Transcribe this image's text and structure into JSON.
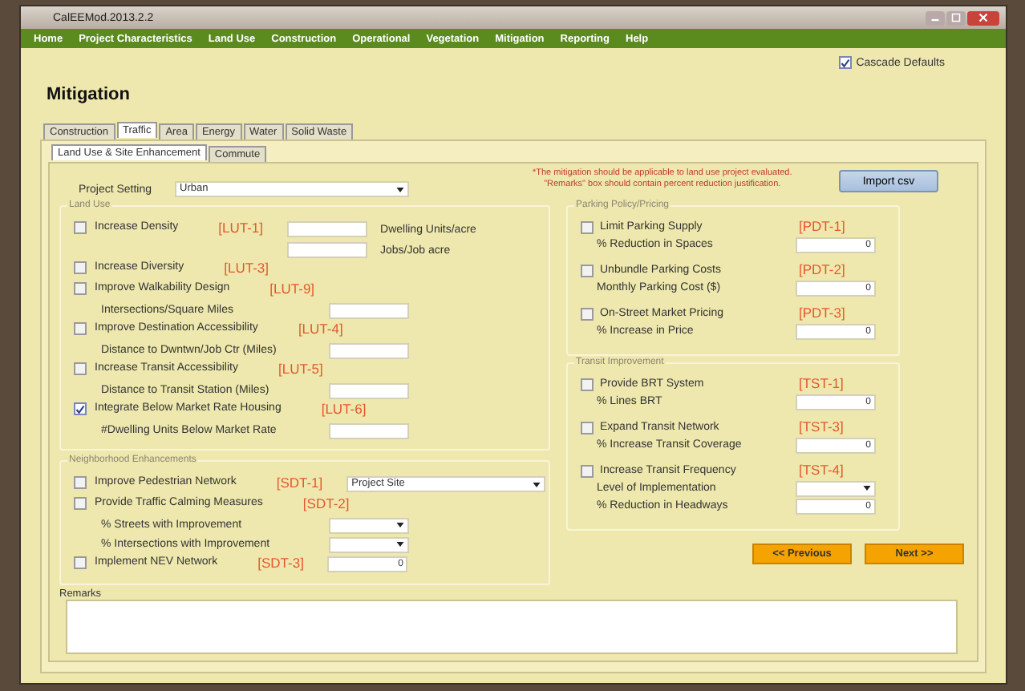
{
  "window": {
    "title": "CalEEMod.2013.2.2"
  },
  "menu": [
    "Home",
    "Project Characteristics",
    "Land Use",
    "Construction",
    "Operational",
    "Vegetation",
    "Mitigation",
    "Reporting",
    "Help"
  ],
  "cascade_defaults": {
    "label": "Cascade Defaults",
    "checked": true
  },
  "page_title": "Mitigation",
  "tabs": [
    {
      "label": "Construction",
      "selected": false
    },
    {
      "label": "Traffic",
      "selected": true
    },
    {
      "label": "Area",
      "selected": false
    },
    {
      "label": "Energy",
      "selected": false
    },
    {
      "label": "Water",
      "selected": false
    },
    {
      "label": "Solid Waste",
      "selected": false
    }
  ],
  "subtabs": [
    {
      "label": "Land Use & Site Enhancement",
      "selected": true
    },
    {
      "label": "Commute",
      "selected": false
    }
  ],
  "project_setting": {
    "label": "Project Setting",
    "value": "Urban"
  },
  "notice": [
    "*The mitigation should be applicable to land use project evaluated.",
    "\"Remarks\" box should contain percent reduction justification."
  ],
  "import_button": "Import csv",
  "land_use": {
    "title": "Land Use",
    "items": [
      {
        "label": "Increase Density",
        "code": "[LUT-1]",
        "checked": false,
        "inline": [
          {
            "kind": "input",
            "unit": "Dwelling Units/acre"
          },
          {
            "kind": "input",
            "unit": "Jobs/Job acre"
          }
        ]
      },
      {
        "label": "Increase Diversity",
        "code": "[LUT-3]",
        "checked": false
      },
      {
        "label": "Improve Walkability Design",
        "code": "[LUT-9]",
        "checked": false,
        "fields": [
          {
            "label": "Intersections/Square Miles",
            "kind": "input"
          }
        ]
      },
      {
        "label": "Improve Destination Accessibility",
        "code": "[LUT-4]",
        "checked": false,
        "fields": [
          {
            "label": "Distance to Dwntwn/Job Ctr (Miles)",
            "kind": "input"
          }
        ]
      },
      {
        "label": "Increase Transit Accessibility",
        "code": "[LUT-5]",
        "checked": false,
        "fields": [
          {
            "label": "Distance to Transit Station (Miles)",
            "kind": "input"
          }
        ]
      },
      {
        "label": "Integrate Below Market Rate Housing",
        "code": "[LUT-6]",
        "checked": true,
        "fields": [
          {
            "label": "#Dwelling Units Below Market Rate",
            "kind": "input"
          }
        ]
      }
    ]
  },
  "neighborhood": {
    "title": "Neighborhood Enhancements",
    "items": [
      {
        "label": "Improve Pedestrian Network",
        "code": "[SDT-1]",
        "checked": false,
        "inline": [
          {
            "kind": "select",
            "value": "Project Site"
          }
        ]
      },
      {
        "label": "Provide Traffic Calming Measures",
        "code": "[SDT-2]",
        "checked": false,
        "fields": [
          {
            "label": "% Streets with Improvement",
            "kind": "select"
          },
          {
            "label": "% Intersections with Improvement",
            "kind": "select"
          }
        ]
      },
      {
        "label": "Implement NEV Network",
        "code": "[SDT-3]",
        "checked": false,
        "inline": [
          {
            "kind": "input",
            "value": "0"
          }
        ]
      }
    ]
  },
  "parking": {
    "title": "Parking Policy/Pricing",
    "items": [
      {
        "label": "Limit Parking Supply",
        "code": "[PDT-1]",
        "checked": false,
        "fields": [
          {
            "label": "% Reduction in Spaces",
            "kind": "input",
            "value": "0"
          }
        ]
      },
      {
        "label": "Unbundle Parking Costs",
        "code": "[PDT-2]",
        "checked": false,
        "fields": [
          {
            "label": "Monthly Parking Cost ($)",
            "kind": "input",
            "value": "0"
          }
        ]
      },
      {
        "label": "On-Street Market Pricing",
        "code": "[PDT-3]",
        "checked": false,
        "fields": [
          {
            "label": "% Increase in Price",
            "kind": "input",
            "value": "0"
          }
        ]
      }
    ]
  },
  "transit": {
    "title": "Transit Improvement",
    "items": [
      {
        "label": "Provide BRT System",
        "code": "[TST-1]",
        "checked": false,
        "fields": [
          {
            "label": "% Lines BRT",
            "kind": "input",
            "value": "0"
          }
        ]
      },
      {
        "label": "Expand Transit Network",
        "code": "[TST-3]",
        "checked": false,
        "fields": [
          {
            "label": "% Increase Transit Coverage",
            "kind": "input",
            "value": "0"
          }
        ]
      },
      {
        "label": "Increase Transit Frequency",
        "code": "[TST-4]",
        "checked": false,
        "fields": [
          {
            "label": "Level of Implementation",
            "kind": "select"
          },
          {
            "label": "% Reduction in Headways",
            "kind": "input",
            "value": "0"
          }
        ]
      }
    ]
  },
  "nav_buttons": [
    "<< Previous",
    "Next >>"
  ],
  "remarks": {
    "label": "Remarks"
  }
}
